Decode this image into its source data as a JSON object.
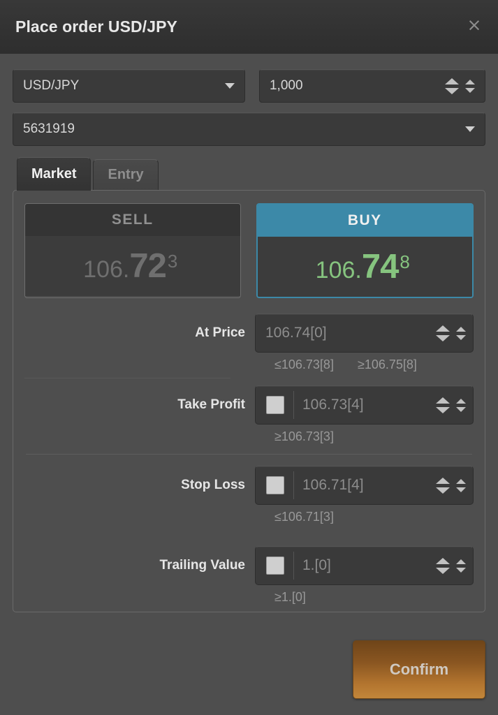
{
  "window": {
    "title": "Place order USD/JPY",
    "close_icon": "close-icon",
    "close_glyph": "×"
  },
  "form": {
    "symbol": {
      "label": "symbol-select",
      "value": "USD/JPY",
      "caret_icon": "chevron-down-icon"
    },
    "quantity": {
      "value": "1,000"
    },
    "account": {
      "value": "5631919",
      "caret_icon": "chevron-down-icon"
    }
  },
  "tabs": [
    {
      "label": "Market",
      "active": true
    },
    {
      "label": "Entry",
      "active": false
    }
  ],
  "tiles": {
    "sell": {
      "heading": "SELL",
      "price_prefix": "106.",
      "price_main": "72",
      "price_sup": "3",
      "color": "#6f6f6f",
      "header_bg": "#343434"
    },
    "buy": {
      "heading": "BUY",
      "price_prefix": "106.",
      "price_main": "74",
      "price_sup": "8",
      "color": "#86c47f",
      "header_bg": "#3c89a8",
      "selected": true
    }
  },
  "fields": [
    {
      "label": "At Price",
      "value": "106.74[0]",
      "has_checkbox": false,
      "hints": [
        "≤106.73[8]",
        "≥106.75[8]"
      ]
    },
    {
      "label": "Take Profit",
      "value": "106.73[4]",
      "has_checkbox": true,
      "checked": false,
      "hints": [
        "≥106.73[3]"
      ]
    },
    {
      "label": "Stop Loss",
      "value": "106.71[4]",
      "has_checkbox": true,
      "checked": false,
      "hints": [
        "≤106.71[3]"
      ]
    },
    {
      "label": "Trailing Value",
      "value": "1.[0]",
      "has_checkbox": true,
      "checked": false,
      "hints": [
        "≥1.[0]"
      ]
    }
  ],
  "footer": {
    "confirm_label": "Confirm",
    "confirm_color": "#b3752f"
  },
  "colors": {
    "dialog_bg": "#4e4e4e",
    "titlebar_bg": "#323232",
    "control_bg": "#3a3a3a",
    "accent_buy": "#3c89a8",
    "accent_green": "#86c47f",
    "accent_confirm": "#b3752f"
  }
}
